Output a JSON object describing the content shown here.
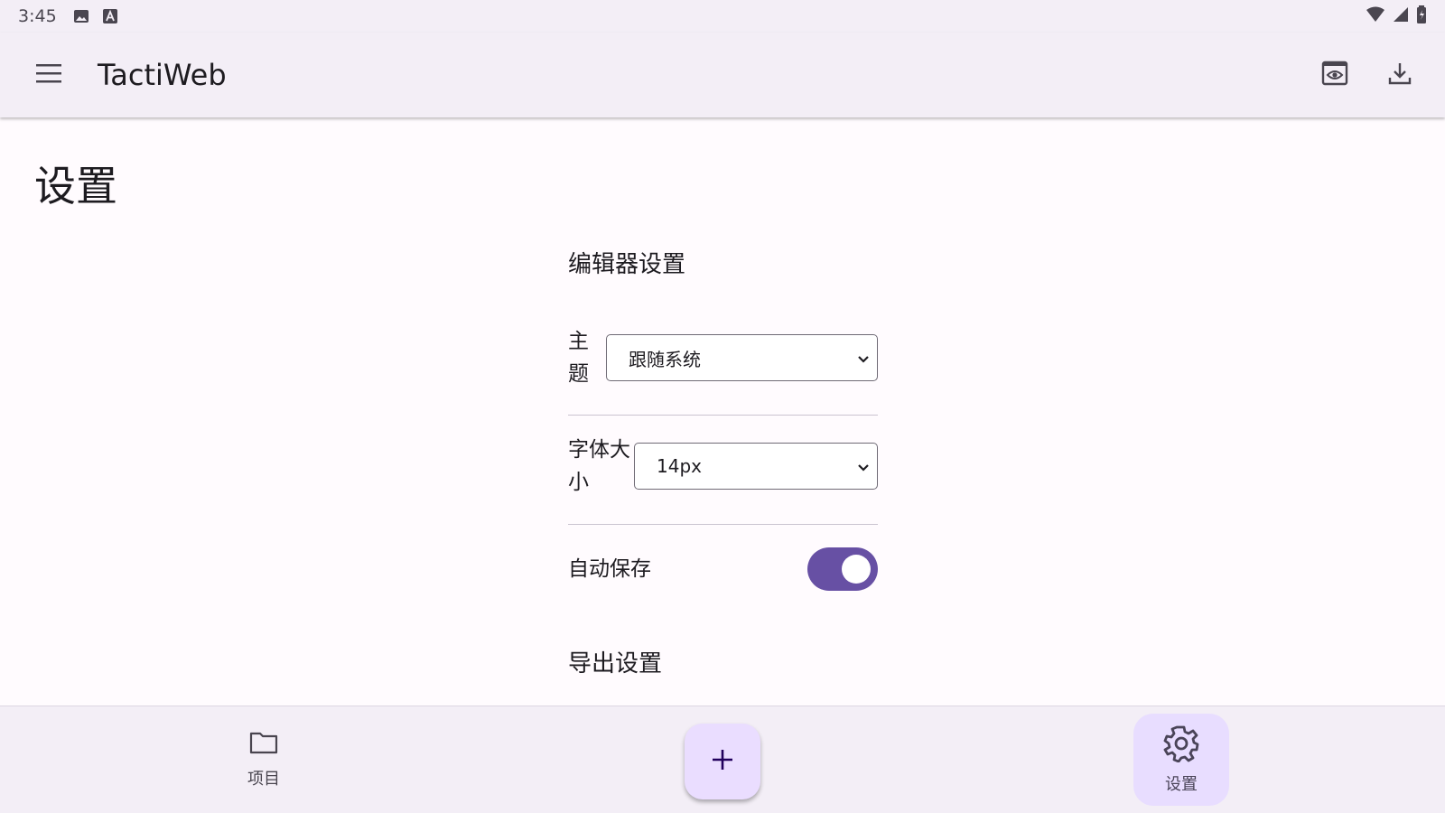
{
  "status_bar": {
    "time": "3:45",
    "left_icons": [
      "image-icon",
      "text-a-icon"
    ],
    "right_icons": [
      "wifi-icon",
      "cell-signal-icon",
      "battery-icon"
    ]
  },
  "app_bar": {
    "title": "TactiWeb",
    "menu_icon": "menu-icon",
    "actions": [
      "preview-icon",
      "download-icon"
    ]
  },
  "page": {
    "title": "设置",
    "editor_section": {
      "title": "编辑器设置",
      "theme": {
        "label": "主题",
        "label_line1": "主",
        "label_line2": "题",
        "value": "跟随系统"
      },
      "font_size": {
        "label": "字体大小",
        "label_line1": "字体大",
        "label_line2": "小",
        "value": "14px"
      },
      "autosave": {
        "label": "自动保存",
        "enabled": true
      }
    },
    "export_section": {
      "title": "导出设置"
    }
  },
  "bottom_nav": {
    "projects_label": "项目",
    "settings_label": "设置",
    "fab_label": "+",
    "active": "settings"
  },
  "colors": {
    "accent": "#6750a4",
    "active_nav_bg": "#e8ddff",
    "fab_bg": "#eaddff",
    "surface": "#fffbfe",
    "bar_bg": "#f3eef6"
  }
}
